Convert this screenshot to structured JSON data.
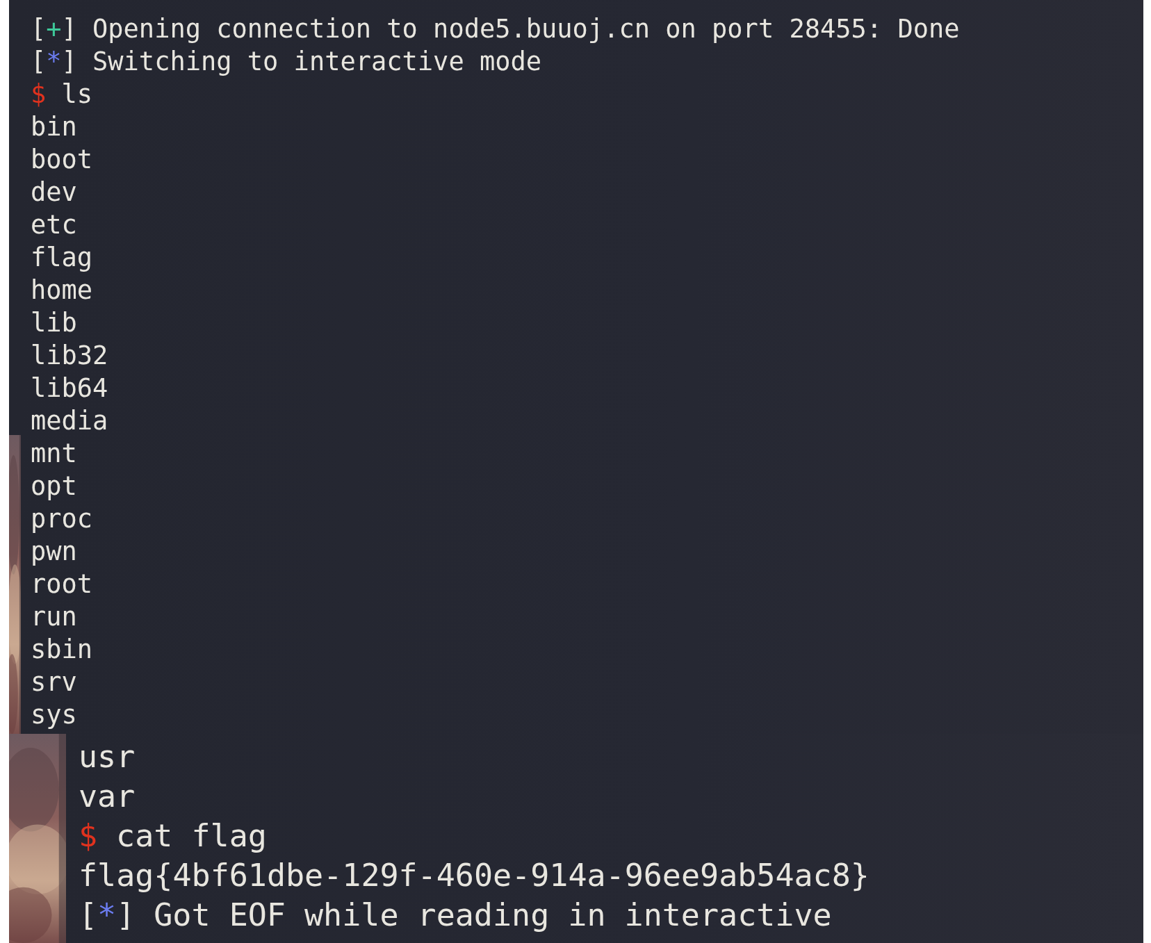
{
  "upper_terminal": {
    "lines": [
      {
        "kind": "status",
        "marker_left": "[",
        "marker": "+",
        "marker_right": "]",
        "text": "Opening connection to node5.buuoj.cn on port 28455: Done",
        "color": "#3ec99a"
      },
      {
        "kind": "status",
        "marker_left": "[",
        "marker": "*",
        "marker_right": "]",
        "text": "Switching to interactive mode",
        "color": "#6b7cf0"
      },
      {
        "kind": "prompt",
        "symbol": "$",
        "text": "ls",
        "color": "#e0321e"
      },
      {
        "kind": "output",
        "text": "bin"
      },
      {
        "kind": "output",
        "text": "boot"
      },
      {
        "kind": "output",
        "text": "dev"
      },
      {
        "kind": "output",
        "text": "etc"
      },
      {
        "kind": "output",
        "text": "flag"
      },
      {
        "kind": "output",
        "text": "home"
      },
      {
        "kind": "output",
        "text": "lib"
      },
      {
        "kind": "output",
        "text": "lib32"
      },
      {
        "kind": "output",
        "text": "lib64"
      },
      {
        "kind": "output",
        "text": "media"
      },
      {
        "kind": "output",
        "text": "mnt"
      },
      {
        "kind": "output",
        "text": "opt"
      },
      {
        "kind": "output",
        "text": "proc"
      },
      {
        "kind": "output",
        "text": "pwn"
      },
      {
        "kind": "output",
        "text": "root"
      },
      {
        "kind": "output",
        "text": "run"
      },
      {
        "kind": "output",
        "text": "sbin"
      },
      {
        "kind": "output",
        "text": "srv"
      },
      {
        "kind": "output",
        "text": "sys"
      }
    ]
  },
  "lower_terminal": {
    "lines": [
      {
        "kind": "output",
        "text": "usr"
      },
      {
        "kind": "output",
        "text": "var"
      },
      {
        "kind": "prompt",
        "symbol": "$",
        "text": "cat flag",
        "color": "#e0321e"
      },
      {
        "kind": "output",
        "text": "flag{4bf61dbe-129f-460e-914a-96ee9ab54ac8}"
      },
      {
        "kind": "status",
        "marker_left": "[",
        "marker": "*",
        "marker_right": "]",
        "text": "Got EOF while reading in interactive",
        "color": "#6b7cf0"
      }
    ]
  }
}
